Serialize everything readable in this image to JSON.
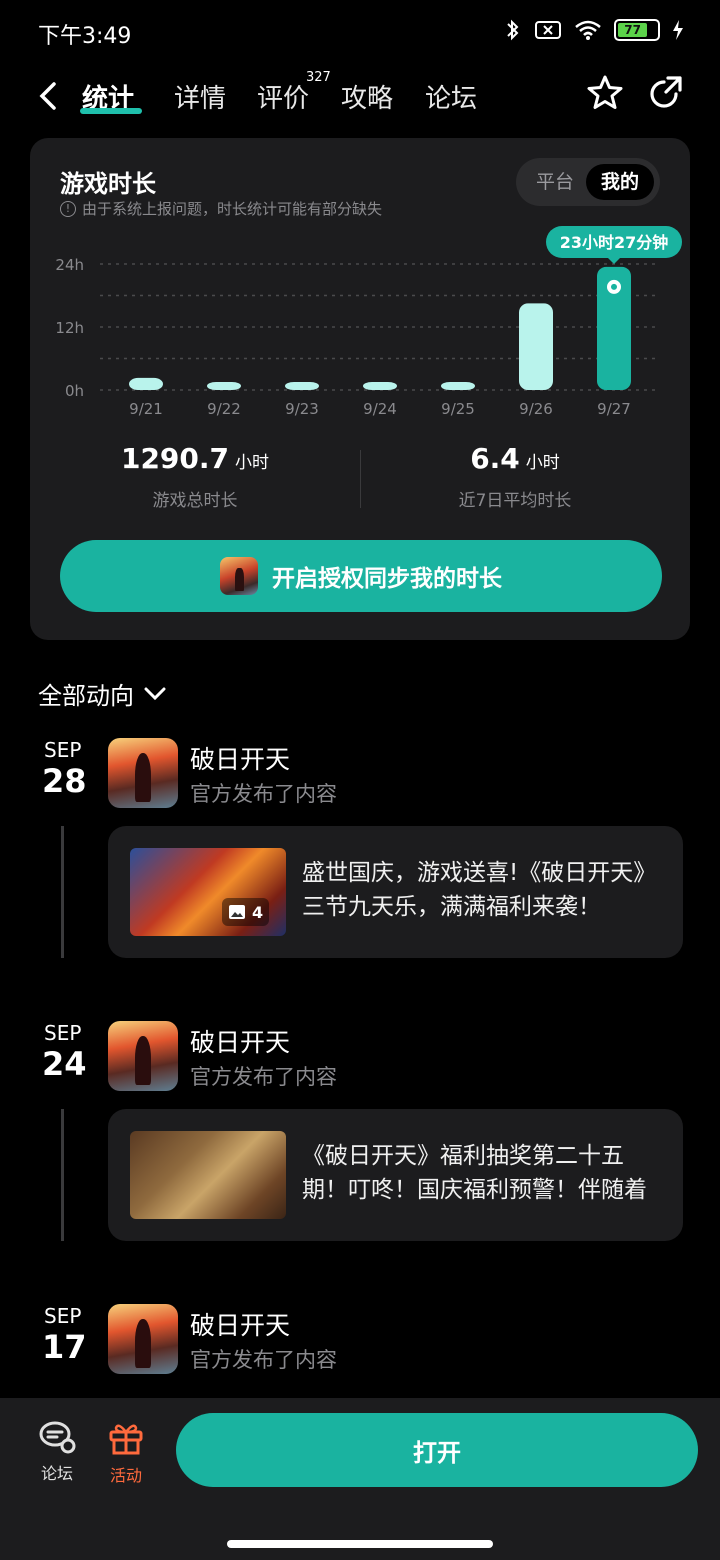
{
  "status": {
    "time": "下午3:49",
    "battery": "77"
  },
  "nav": {
    "tabs": [
      "统计",
      "详情",
      "评价",
      "攻略",
      "论坛"
    ],
    "review_count": "327"
  },
  "stats_card": {
    "title": "游戏时长",
    "note": "由于系统上报问题，时长统计可能有部分缺失",
    "segment": {
      "platform": "平台",
      "mine": "我的"
    },
    "tooltip": "23小时27分钟",
    "total_value": "1290.7",
    "total_unit": "小时",
    "total_label": "游戏总时长",
    "avg_value": "6.4",
    "avg_unit": "小时",
    "avg_label": "近7日平均时长",
    "auth_button": "开启授权同步我的时长"
  },
  "chart_data": {
    "type": "bar",
    "categories": [
      "9/21",
      "9/22",
      "9/23",
      "9/24",
      "9/25",
      "9/26",
      "9/27"
    ],
    "values": [
      2.3,
      1.0,
      1.0,
      1.0,
      1.0,
      16.5,
      23.45
    ],
    "ylim": [
      0,
      24
    ],
    "yticks": [
      "0h",
      "12h",
      "24h"
    ],
    "highlight_index": 6,
    "bar_color": "#b9f3ec",
    "highlight_color": "#1ab3a0",
    "grid": true
  },
  "feed": {
    "filter_label": "全部动向",
    "items": [
      {
        "month": "SEP",
        "day": "28",
        "name": "破日开天",
        "sub": "官方发布了内容",
        "text": "盛世国庆，游戏送喜!《破日开天》三节九天乐，满满福利来袭！",
        "img_count": "4"
      },
      {
        "month": "SEP",
        "day": "24",
        "name": "破日开天",
        "sub": "官方发布了内容",
        "text": "《破日开天》福利抽奖第二十五期！叮咚！国庆福利预警！伴随着",
        "img_count": ""
      },
      {
        "month": "SEP",
        "day": "17",
        "name": "破日开天",
        "sub": "官方发布了内容",
        "text": "",
        "img_count": ""
      }
    ]
  },
  "bottom": {
    "forum": "论坛",
    "activity": "活动",
    "open": "打开"
  },
  "colors": {
    "accent": "#1ab3a0",
    "activity": "#ff6a3d"
  }
}
